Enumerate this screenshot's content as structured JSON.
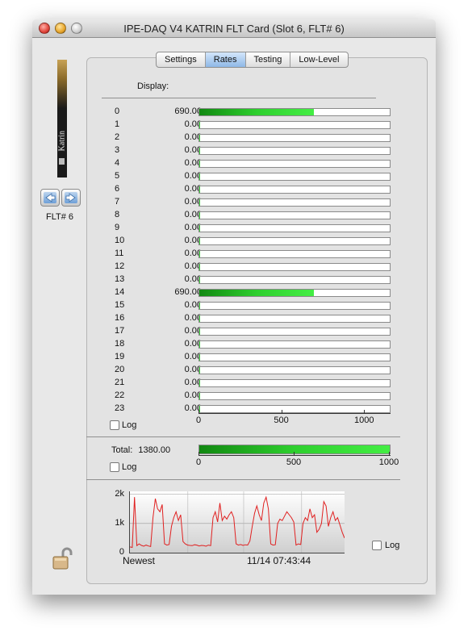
{
  "window": {
    "title": "IPE-DAQ V4 KATRIN FLT Card (Slot 6, FLT# 6)"
  },
  "card": {
    "brand": "Katrin",
    "flt_label": "FLT# 6"
  },
  "tabs": [
    {
      "label": "Settings",
      "active": false
    },
    {
      "label": "Rates",
      "active": true
    },
    {
      "label": "Testing",
      "active": false
    },
    {
      "label": "Low-Level",
      "active": false
    }
  ],
  "display_label": "Display:",
  "channels": [
    {
      "index": "0",
      "rate": "690.00",
      "value": 690
    },
    {
      "index": "1",
      "rate": "0.00",
      "value": 0
    },
    {
      "index": "2",
      "rate": "0.00",
      "value": 0
    },
    {
      "index": "3",
      "rate": "0.00",
      "value": 0
    },
    {
      "index": "4",
      "rate": "0.00",
      "value": 0
    },
    {
      "index": "5",
      "rate": "0.00",
      "value": 0
    },
    {
      "index": "6",
      "rate": "0.00",
      "value": 0
    },
    {
      "index": "7",
      "rate": "0.00",
      "value": 0
    },
    {
      "index": "8",
      "rate": "0.00",
      "value": 0
    },
    {
      "index": "9",
      "rate": "0.00",
      "value": 0
    },
    {
      "index": "10",
      "rate": "0.00",
      "value": 0
    },
    {
      "index": "11",
      "rate": "0.00",
      "value": 0
    },
    {
      "index": "12",
      "rate": "0.00",
      "value": 0
    },
    {
      "index": "13",
      "rate": "0.00",
      "value": 0
    },
    {
      "index": "14",
      "rate": "690.00",
      "value": 690
    },
    {
      "index": "15",
      "rate": "0.00",
      "value": 0
    },
    {
      "index": "16",
      "rate": "0.00",
      "value": 0
    },
    {
      "index": "17",
      "rate": "0.00",
      "value": 0
    },
    {
      "index": "18",
      "rate": "0.00",
      "value": 0
    },
    {
      "index": "19",
      "rate": "0.00",
      "value": 0
    },
    {
      "index": "20",
      "rate": "0.00",
      "value": 0
    },
    {
      "index": "21",
      "rate": "0.00",
      "value": 0
    },
    {
      "index": "22",
      "rate": "0.00",
      "value": 0
    },
    {
      "index": "23",
      "rate": "0.00",
      "value": 0
    }
  ],
  "rates_scale": {
    "max": 1150,
    "ticks": [
      "0",
      "500",
      "1000"
    ],
    "tick_values": [
      0,
      500,
      1000
    ]
  },
  "rates_log": {
    "label": "Log",
    "checked": false
  },
  "total": {
    "label": "Total:",
    "value_text": "1380.00",
    "value": 1380,
    "scale_max": 1000,
    "ticks": [
      "0",
      "500",
      "1000"
    ],
    "tick_values": [
      0,
      500,
      1000
    ]
  },
  "total_log": {
    "label": "Log",
    "checked": false
  },
  "history": {
    "y_ticks": [
      "2k",
      "1k",
      "0"
    ],
    "y_tick_values": [
      2000,
      1000,
      0
    ],
    "y_max": 2100,
    "x_left_label": "Newest",
    "x_right_label": "11/14 07:43:44",
    "line_color": "#e02020",
    "log": {
      "label": "Log",
      "checked": false
    },
    "samples": [
      200,
      180,
      1900,
      240,
      300,
      250,
      220,
      260,
      230,
      210,
      1200,
      1850,
      1500,
      1400,
      1650,
      300,
      260,
      280,
      900,
      1200,
      1400,
      1100,
      1300,
      380,
      300,
      260,
      250,
      240,
      270,
      260,
      230,
      250,
      240,
      220,
      260,
      240,
      1200,
      1400,
      1050,
      1700,
      1100,
      1250,
      1150,
      1300,
      1400,
      1200,
      300,
      260,
      280,
      250,
      270,
      260,
      400,
      900,
      1350,
      1600,
      1300,
      1100,
      1700,
      1900,
      1500,
      300,
      260,
      270,
      1000,
      1150,
      1100,
      1250,
      1400,
      1300,
      1200,
      1050,
      260,
      300,
      280,
      1000,
      1200,
      1100,
      1500,
      1200,
      1300,
      700,
      800,
      1000,
      1750,
      1600,
      900,
      1200,
      1400,
      1100,
      1200,
      950,
      700,
      500
    ]
  }
}
